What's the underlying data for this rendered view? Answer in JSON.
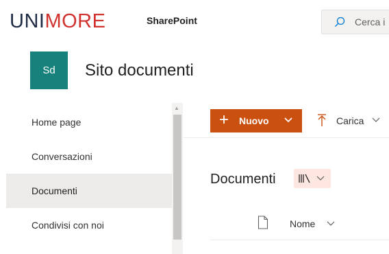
{
  "suite": {
    "brand_part1": "UNI",
    "brand_part2": "MORE",
    "app_name": "SharePoint",
    "search_placeholder": "Cerca i"
  },
  "site": {
    "logo_initials": "Sd",
    "title": "Sito documenti"
  },
  "leftnav": {
    "items": [
      {
        "label": "Home page"
      },
      {
        "label": "Conversazioni"
      },
      {
        "label": "Documenti",
        "active": true
      },
      {
        "label": "Condivisi con noi"
      }
    ]
  },
  "commandbar": {
    "new_label": "Nuovo",
    "upload_label": "Carica"
  },
  "library": {
    "title": "Documenti",
    "column_name": "Nome"
  },
  "colors": {
    "brand_red": "#d0312d",
    "brand_navy": "#1f2a44",
    "site_logo_bg": "#17827c",
    "new_button_bg": "#ca5010",
    "active_nav_bg": "#edebe9"
  }
}
